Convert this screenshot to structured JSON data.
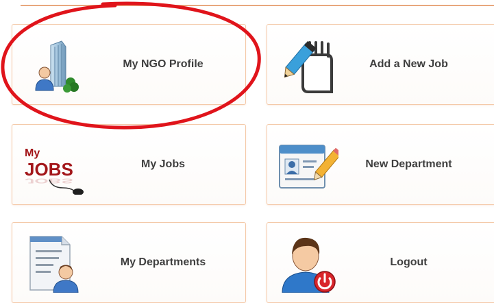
{
  "colors": {
    "tile_border": "#f4c9a8",
    "top_rule": "#e8a77d",
    "annotation": "#e0141b",
    "label_text": "#3f3f3f",
    "jobs_red": "#a3161a"
  },
  "tiles": [
    {
      "label": "My NGO Profile",
      "icon": "ngo-building-user-icon"
    },
    {
      "label": "Add a New Job",
      "icon": "notepad-pencil-icon"
    },
    {
      "label": "My Jobs",
      "icon": "my-jobs-mouse-icon",
      "icon_text_top": "My",
      "icon_text_main": "JOBS"
    },
    {
      "label": "New Department",
      "icon": "id-card-pencil-icon"
    },
    {
      "label": "My Departments",
      "icon": "document-user-icon"
    },
    {
      "label": "Logout",
      "icon": "user-power-icon"
    }
  ]
}
